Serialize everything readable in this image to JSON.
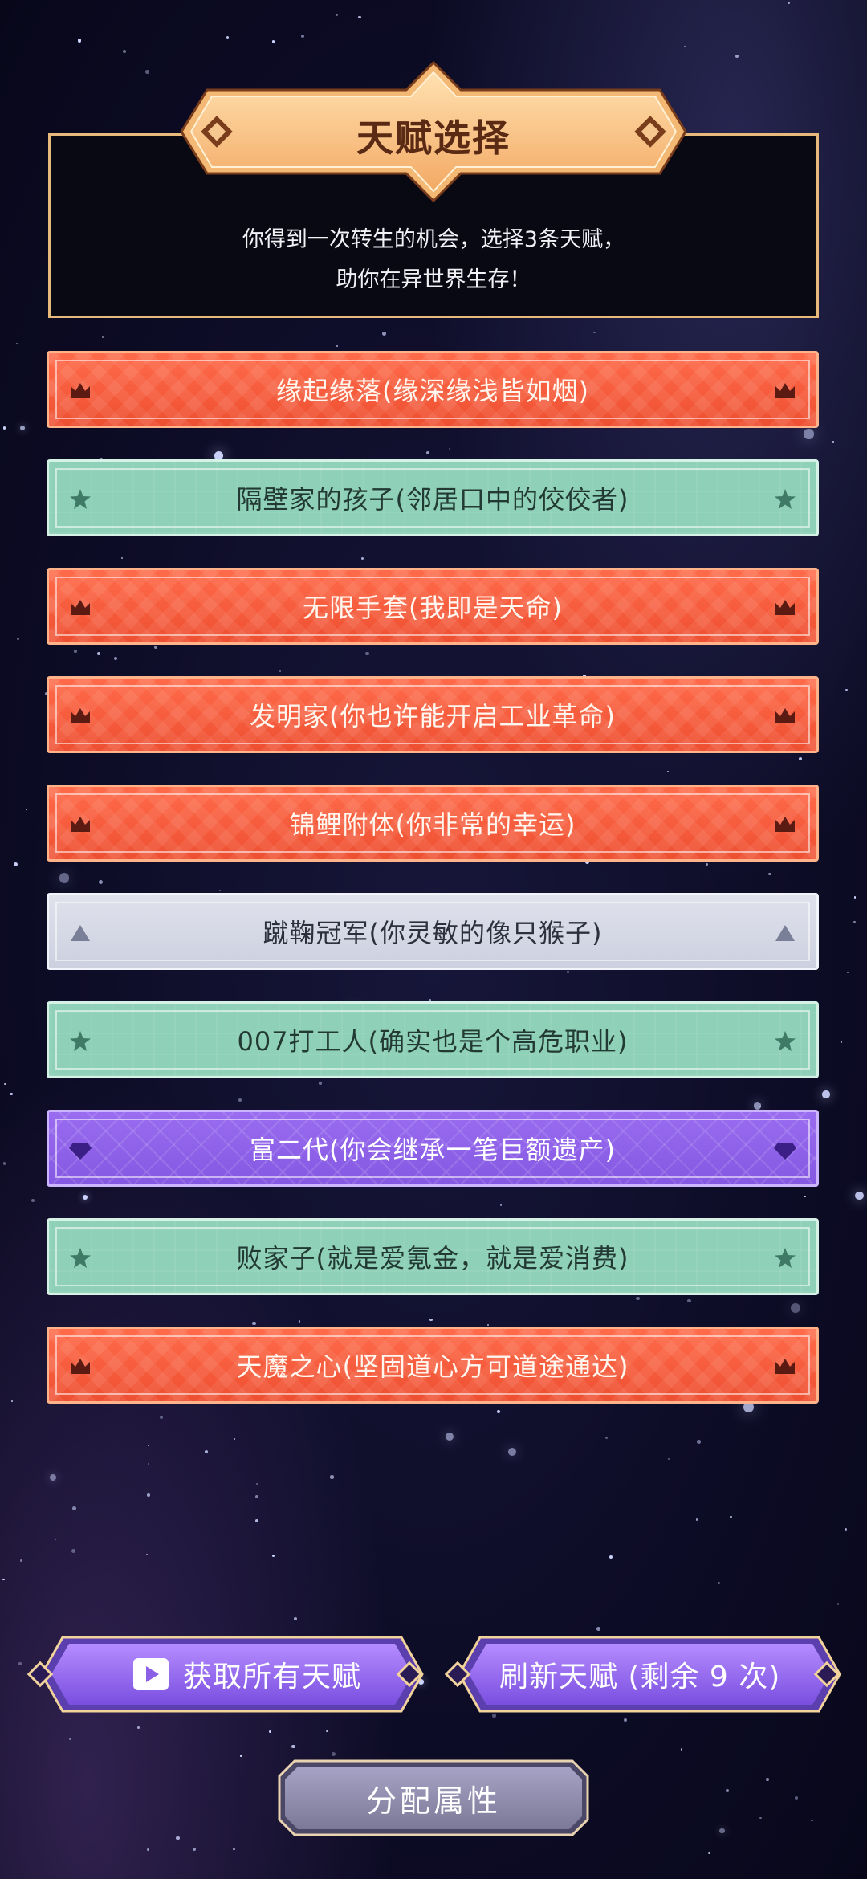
{
  "header": {
    "title": "天赋选择",
    "description_line1": "你得到一次转生的机会，选择3条天赋，",
    "description_line2": "助你在异世界生存！"
  },
  "talents": [
    {
      "label": "缘起缘落(缘深缘浅皆如烟)",
      "rarity": "red",
      "icon": "crown-icon"
    },
    {
      "label": "隔壁家的孩子(邻居口中的佼佼者)",
      "rarity": "green",
      "icon": "star-icon"
    },
    {
      "label": "无限手套(我即是天命)",
      "rarity": "red",
      "icon": "crown-icon"
    },
    {
      "label": "发明家(你也许能开启工业革命)",
      "rarity": "red",
      "icon": "crown-icon"
    },
    {
      "label": "锦鲤附体(你非常的幸运)",
      "rarity": "red",
      "icon": "crown-icon"
    },
    {
      "label": "蹴鞠冠军(你灵敏的像只猴子)",
      "rarity": "grey",
      "icon": "triangle-icon"
    },
    {
      "label": "007打工人(确实也是个高危职业)",
      "rarity": "green",
      "icon": "star-icon"
    },
    {
      "label": "富二代(你会继承一笔巨额遗产)",
      "rarity": "purple",
      "icon": "diamond-icon"
    },
    {
      "label": "败家子(就是爱氪金，就是爱消费)",
      "rarity": "green",
      "icon": "star-icon"
    },
    {
      "label": "天魔之心(坚固道心方可道途通达)",
      "rarity": "red",
      "icon": "crown-icon"
    }
  ],
  "buttons": {
    "get_all": "获取所有天赋",
    "refresh": "刷新天赋 (剩余 9 次)",
    "assign": "分配属性"
  },
  "colors": {
    "red": "#f15a3a",
    "green": "#8fd0b8",
    "grey": "#d6d8e5",
    "purple": "#8c60e8",
    "gold": "#f7c07e"
  }
}
